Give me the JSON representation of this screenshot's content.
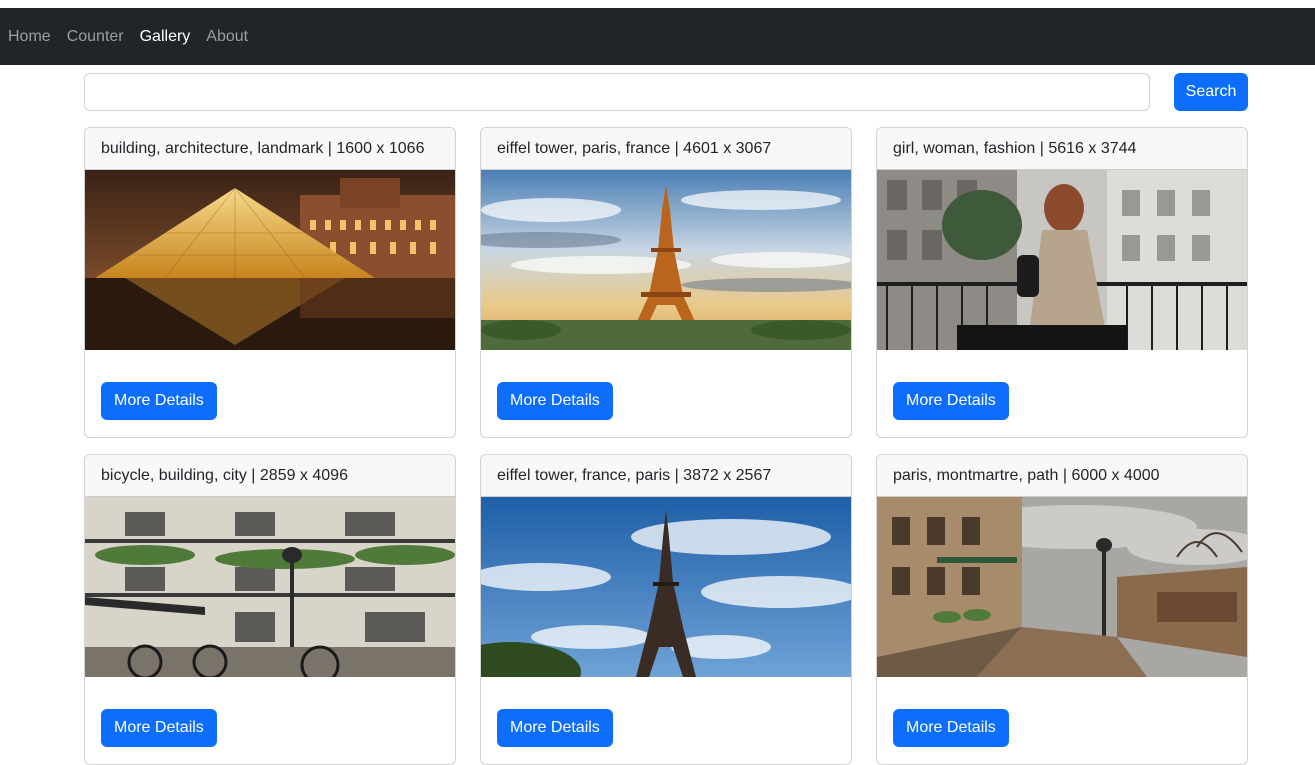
{
  "nav": {
    "items": [
      {
        "label": "Home",
        "active": false
      },
      {
        "label": "Counter",
        "active": false
      },
      {
        "label": "Gallery",
        "active": true
      },
      {
        "label": "About",
        "active": false
      }
    ]
  },
  "search": {
    "value": "",
    "button_label": "Search"
  },
  "cards": [
    {
      "caption": "building, architecture, landmark | 1600 x 1066",
      "button_label": "More Details"
    },
    {
      "caption": "eiffel tower, paris, france | 4601 x 3067",
      "button_label": "More Details"
    },
    {
      "caption": "girl, woman, fashion | 5616 x 3744",
      "button_label": "More Details"
    },
    {
      "caption": "bicycle, building, city | 2859 x 4096",
      "button_label": "More Details"
    },
    {
      "caption": "eiffel tower, france, paris | 3872 x 2567",
      "button_label": "More Details"
    },
    {
      "caption": "paris, montmartre, path | 6000 x 4000",
      "button_label": "More Details"
    }
  ],
  "colors": {
    "navbar_bg": "#212529",
    "primary": "#0d6efd"
  }
}
